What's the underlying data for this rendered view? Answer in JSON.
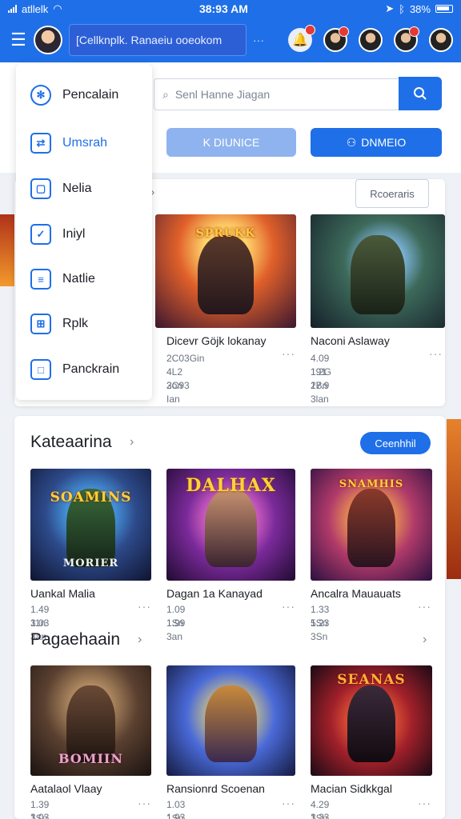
{
  "status_bar": {
    "carrier": "atllelk",
    "time": "38:93 AM",
    "battery": "38%"
  },
  "header": {
    "search_text": "[Cellknplk. Ranaeiu ooeokom",
    "dots": "···"
  },
  "search": {
    "placeholder": "Senl Hanne Jiagan"
  },
  "buttons": {
    "left": "K DIUNICE",
    "right": "DNMEIO"
  },
  "drawer": {
    "items": [
      {
        "label": "Pencalain",
        "icon": "gear-icon"
      },
      {
        "label": "Umsrah",
        "icon": "swap-icon"
      },
      {
        "label": "Nelia",
        "icon": "frame-icon"
      },
      {
        "label": "Iniyl",
        "icon": "check-icon"
      },
      {
        "label": "Natlie",
        "icon": "chat-icon"
      },
      {
        "label": "Rplk",
        "icon": "grid-icon"
      },
      {
        "label": "Panckrain",
        "icon": "square-icon"
      }
    ]
  },
  "section1": {
    "button": "Rcoeraris",
    "items": [
      {
        "title": "Dicevr Göjk lokanay",
        "meta1": "2C03Gin",
        "meta2": "4L2 2on",
        "meta3": "3C93 Ian",
        "logo": "SPRUKK"
      },
      {
        "title": "Naconi Aslaway",
        "meta1": "4.09 191",
        "meta2": "1.2G 2Bn",
        "meta3": "17.9 3lan",
        "logo": ""
      }
    ]
  },
  "section2": {
    "title": "Kateaarina",
    "button": "Ceenhhil",
    "row1": [
      {
        "title": "Uankal Malia",
        "meta1": "1.49 11n",
        "meta2": "3.03 3an",
        "logo": "SOAMINS",
        "logo2": "MORIER"
      },
      {
        "title": "Dagan 1a Kanayad",
        "meta1": "1.09 1Sn",
        "meta2": "1.99 3an",
        "logo": "DALHAX",
        "logo2": ""
      },
      {
        "title": "Ancalra Mauauats",
        "meta1": "1.33 1Sn",
        "meta2": "5.23 3Sn",
        "logo": "SNAMHIS",
        "logo2": ""
      }
    ],
    "subtitle": "Pagaehaain",
    "row2": [
      {
        "title": "Aatalaol Vlaay",
        "meta1": "1.39 1Sn",
        "meta2": "3.03 3an",
        "logo": "BOMIIN"
      },
      {
        "title": "Ransionrd Scoenan",
        "meta1": "1.03 1Sn",
        "meta2": "1.93 3an",
        "logo": ""
      },
      {
        "title": "Macian Sidkkgal",
        "meta1": "4.29 1Sn",
        "meta2": "3.33 3an",
        "logo": "SEANAS"
      }
    ]
  },
  "colors": {
    "primary": "#1f6fe8",
    "background": "#eef1f6"
  }
}
